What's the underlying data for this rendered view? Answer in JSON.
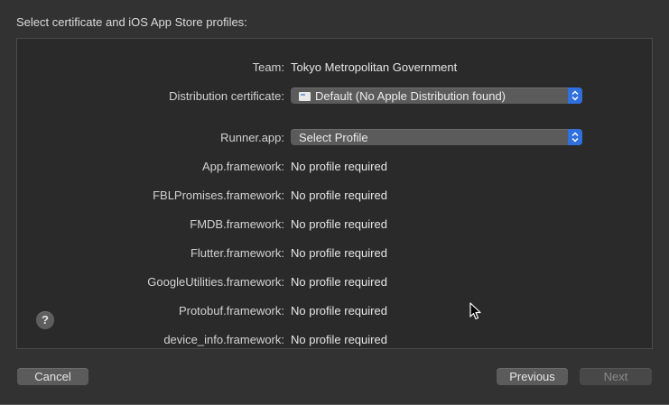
{
  "header": {
    "title": "Select certificate and iOS App Store profiles:"
  },
  "team": {
    "label": "Team:",
    "value": "Tokyo Metropolitan Government"
  },
  "distribution_certificate": {
    "label": "Distribution certificate:",
    "selected": "Default (No Apple Distribution found)",
    "icon": "certificate-icon"
  },
  "profiles": [
    {
      "label": "Runner.app:",
      "value": "Select Profile",
      "control": "popup"
    },
    {
      "label": "App.framework:",
      "value": "No profile required",
      "control": "text"
    },
    {
      "label": "FBLPromises.framework:",
      "value": "No profile required",
      "control": "text"
    },
    {
      "label": "FMDB.framework:",
      "value": "No profile required",
      "control": "text"
    },
    {
      "label": "Flutter.framework:",
      "value": "No profile required",
      "control": "text"
    },
    {
      "label": "GoogleUtilities.framework:",
      "value": "No profile required",
      "control": "text"
    },
    {
      "label": "Protobuf.framework:",
      "value": "No profile required",
      "control": "text"
    },
    {
      "label": "device_info.framework:",
      "value": "No profile required",
      "control": "text"
    }
  ],
  "help": {
    "label": "?"
  },
  "buttons": {
    "cancel": "Cancel",
    "previous": "Previous",
    "next": "Next",
    "next_enabled": false
  },
  "colors": {
    "background": "#323232",
    "panel": "#2a2a2a",
    "popup": "#5b5b5b",
    "accent": "#2f6fde"
  }
}
